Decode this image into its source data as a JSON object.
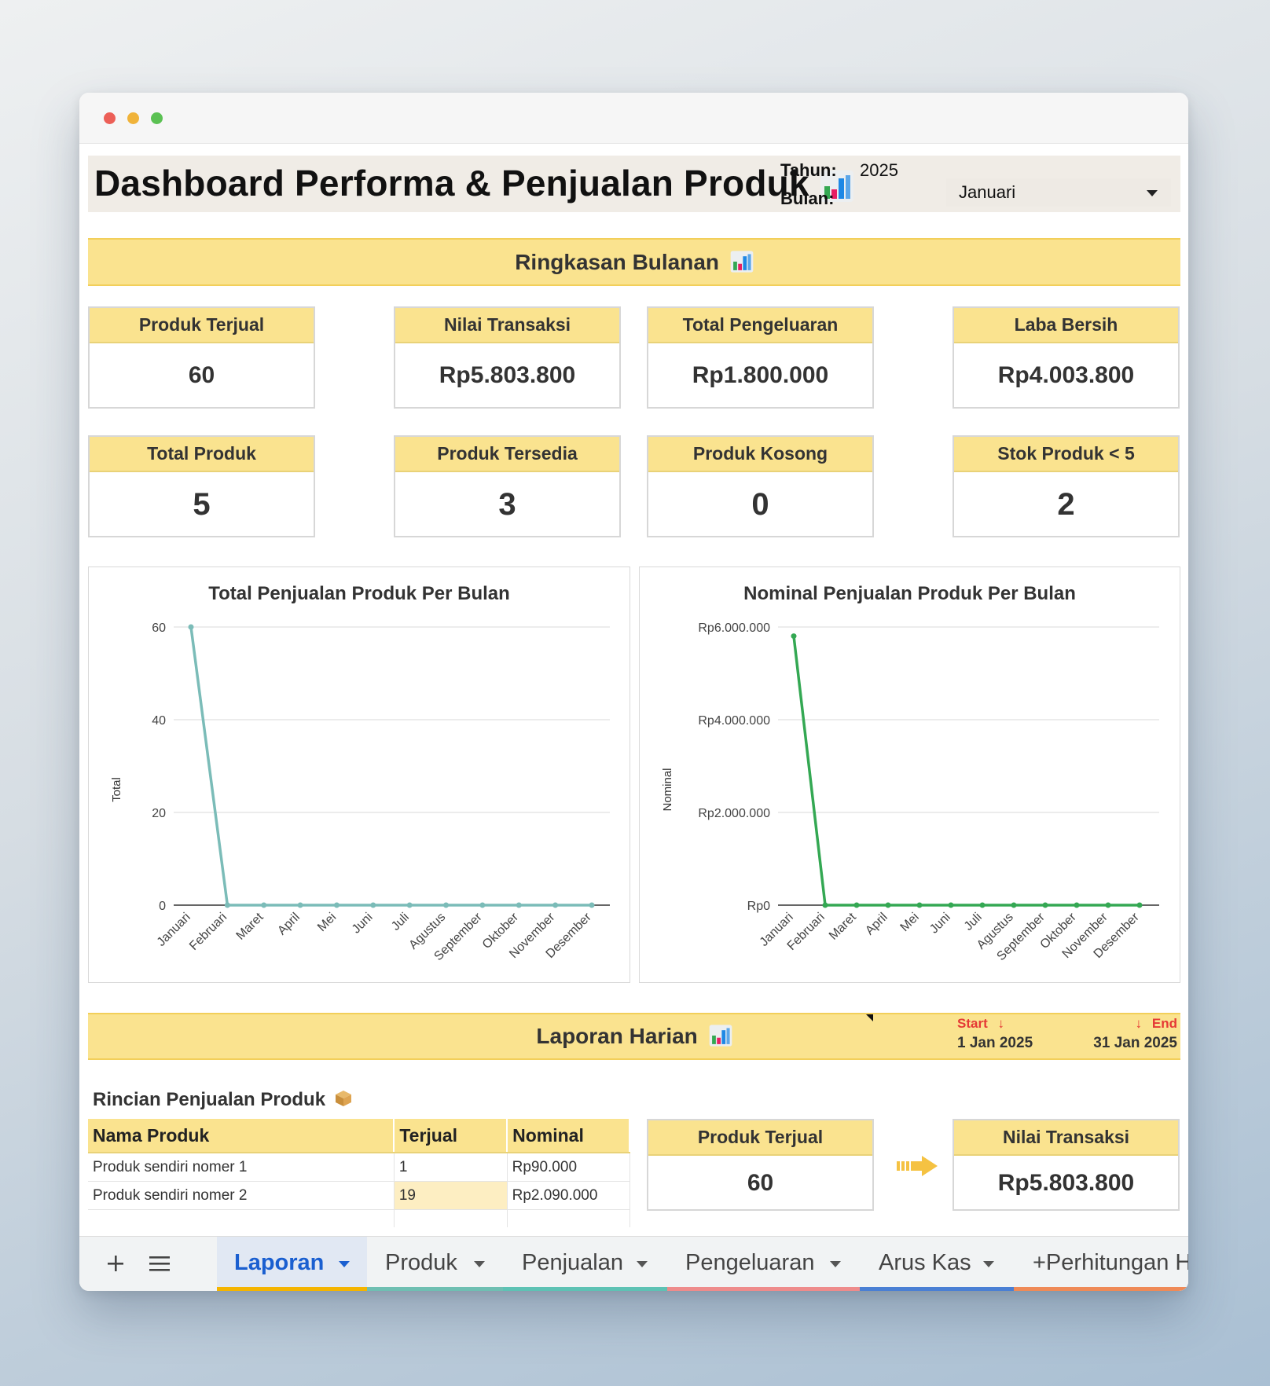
{
  "header": {
    "title": "Dashboard Performa & Penjualan Produk",
    "year_label": "Tahun:",
    "year_value": "2025",
    "month_label": "Bulan:",
    "month_value": "Januari"
  },
  "monthly_summary": {
    "banner": "Ringkasan Bulanan",
    "cards": [
      {
        "title": "Produk Terjual",
        "value": "60"
      },
      {
        "title": "Nilai Transaksi",
        "value": "Rp5.803.800"
      },
      {
        "title": "Total Pengeluaran",
        "value": "Rp1.800.000"
      },
      {
        "title": "Laba Bersih",
        "value": "Rp4.003.800"
      },
      {
        "title": "Total Produk",
        "value": "5"
      },
      {
        "title": "Produk Tersedia",
        "value": "3"
      },
      {
        "title": "Produk Kosong",
        "value": "0"
      },
      {
        "title": "Stok Produk < 5",
        "value": "2"
      }
    ]
  },
  "chart_data": [
    {
      "type": "line",
      "title": "Total Penjualan Produk Per Bulan",
      "xlabel": "",
      "ylabel": "Total",
      "categories": [
        "Januari",
        "Februari",
        "Maret",
        "April",
        "Mei",
        "Juni",
        "Juli",
        "Agustus",
        "September",
        "Oktober",
        "November",
        "Desember"
      ],
      "series": [
        {
          "values": [
            60,
            0,
            0,
            0,
            0,
            0,
            0,
            0,
            0,
            0,
            0,
            0
          ]
        }
      ],
      "ylim": [
        0,
        60
      ],
      "yticks": [
        "0",
        "20",
        "40",
        "60"
      ],
      "color": "#7bbcb8",
      "grid": true
    },
    {
      "type": "line",
      "title": "Nominal Penjualan Produk Per Bulan",
      "xlabel": "",
      "ylabel": "Nominal",
      "categories": [
        "Januari",
        "Februari",
        "Maret",
        "April",
        "Mei",
        "Juni",
        "Juli",
        "Agustus",
        "September",
        "Oktober",
        "November",
        "Desember"
      ],
      "series": [
        {
          "values": [
            5803800,
            0,
            0,
            0,
            0,
            0,
            0,
            0,
            0,
            0,
            0,
            0
          ]
        }
      ],
      "ylim": [
        0,
        6000000
      ],
      "yticks": [
        "Rp0",
        "Rp2.000.000",
        "Rp4.000.000",
        "Rp6.000.000"
      ],
      "color": "#34a853",
      "grid": true
    }
  ],
  "daily_report": {
    "banner": "Laporan Harian",
    "start_label": "Start",
    "start_date": "1 Jan 2025",
    "end_label": "End",
    "end_date": "31 Jan 2025"
  },
  "details": {
    "title": "Rincian Penjualan Produk",
    "columns": [
      "Nama Produk",
      "Terjual",
      "Nominal"
    ],
    "rows": [
      {
        "name": "Produk sendiri nomer 1",
        "sold": "1",
        "amount": "Rp90.000"
      },
      {
        "name": "Produk sendiri nomer 2",
        "sold": "19",
        "amount": "Rp2.090.000"
      }
    ],
    "cards": [
      {
        "title": "Produk Terjual",
        "value": "60"
      },
      {
        "title": "Nilai Transaksi",
        "value": "Rp5.803.800"
      }
    ]
  },
  "tabs": {
    "add_icon": "plus-icon",
    "menu_icon": "hamburger-menu-icon",
    "items": [
      {
        "label": "Laporan",
        "color": "#f4b400",
        "active": true
      },
      {
        "label": "Produk",
        "color": "#6fbfb2"
      },
      {
        "label": "Penjualan",
        "color": "#5ec2b4"
      },
      {
        "label": "Pengeluaran",
        "color": "#ee8b8b"
      },
      {
        "label": "Arus Kas",
        "color": "#4a7fd4"
      },
      {
        "label": "+Perhitungan H",
        "color": "#ef8a57"
      }
    ]
  },
  "colors": {
    "accent_yellow": "#fae38f",
    "header_bg": "#f0ece6",
    "date_red": "#e53935",
    "active_tab_text": "#1a5fd0"
  }
}
